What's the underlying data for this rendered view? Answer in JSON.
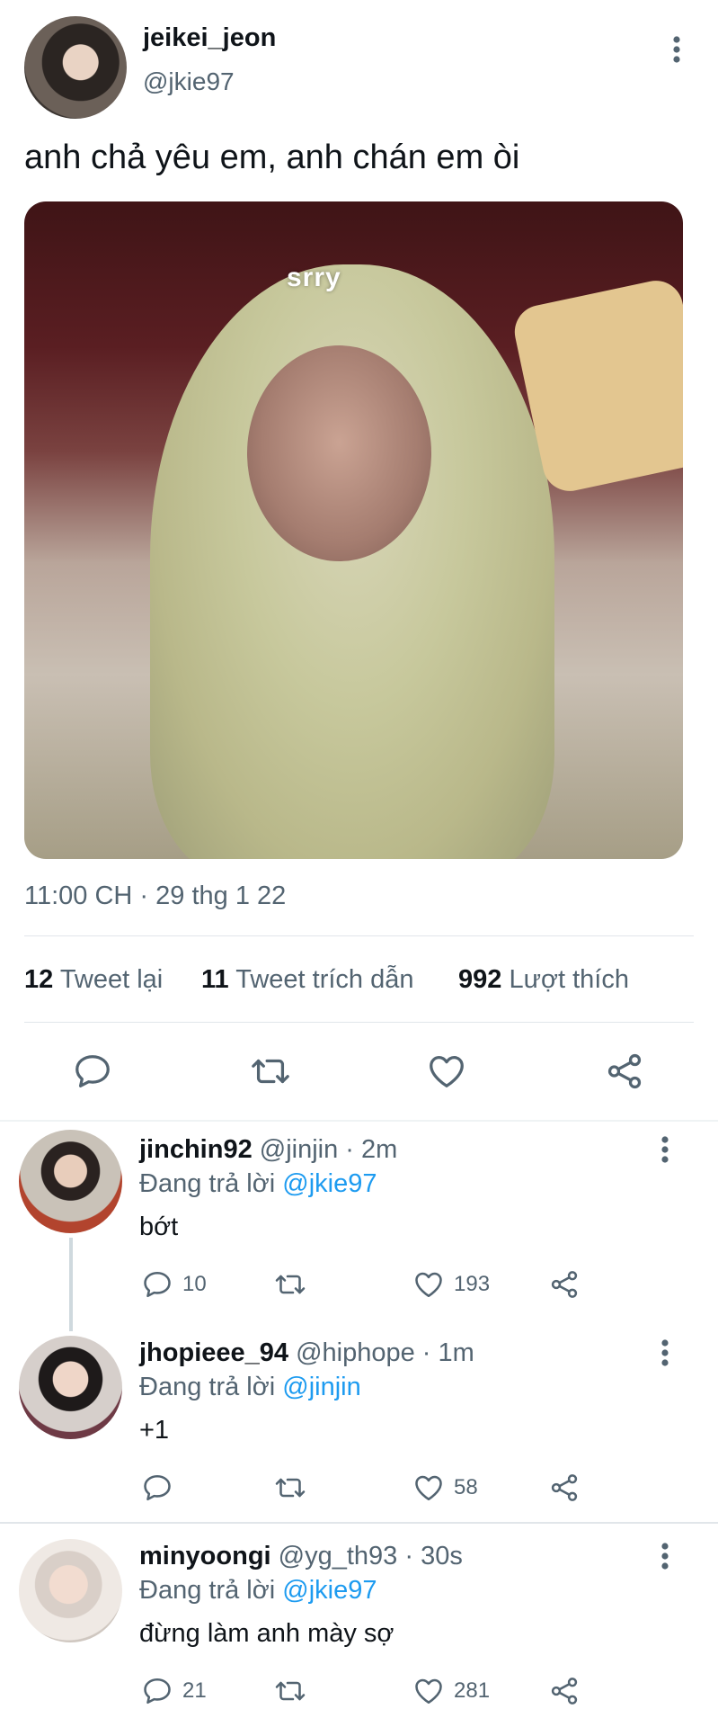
{
  "tweet": {
    "display_name": "jeikei_jeon",
    "handle": "@jkie97",
    "text": "anh chả yêu em, anh chán em òi",
    "media_caption": "srry",
    "timestamp": "11:00 CH · 29 thg 1 22",
    "stats": {
      "retweets_count": "12",
      "retweets_label": "Tweet lại",
      "quotes_count": "11",
      "quotes_label": "Tweet trích dẫn",
      "likes_count": "992",
      "likes_label": "Lượt thích"
    }
  },
  "replies": [
    {
      "display_name": "jinchin92",
      "meta": "@jinjin · 2m",
      "replying_prefix": "Đang trả lời",
      "replying_to": "@jkie97",
      "text": "bớt",
      "reply_count": "10",
      "retweet_count": "",
      "like_count": "193"
    },
    {
      "display_name": "jhopieee_94",
      "meta": "@hiphope · 1m",
      "replying_prefix": "Đang trả lời",
      "replying_to": "@jinjin",
      "text": "+1",
      "reply_count": "",
      "retweet_count": "",
      "like_count": "58"
    },
    {
      "display_name": "minyoongi",
      "meta": "@yg_th93 · 30s",
      "replying_prefix": "Đang trả lời",
      "replying_to": "@jkie97",
      "text": "đừng làm anh mày sợ",
      "reply_count": "21",
      "retweet_count": "",
      "like_count": "281"
    }
  ],
  "icons": {
    "reply": "reply-icon",
    "retweet": "retweet-icon",
    "like": "heart-icon",
    "share": "share-icon",
    "more": "more-vertical-icon"
  },
  "colors": {
    "link": "#1d9bf0",
    "muted": "#536471",
    "text": "#0f1419"
  }
}
